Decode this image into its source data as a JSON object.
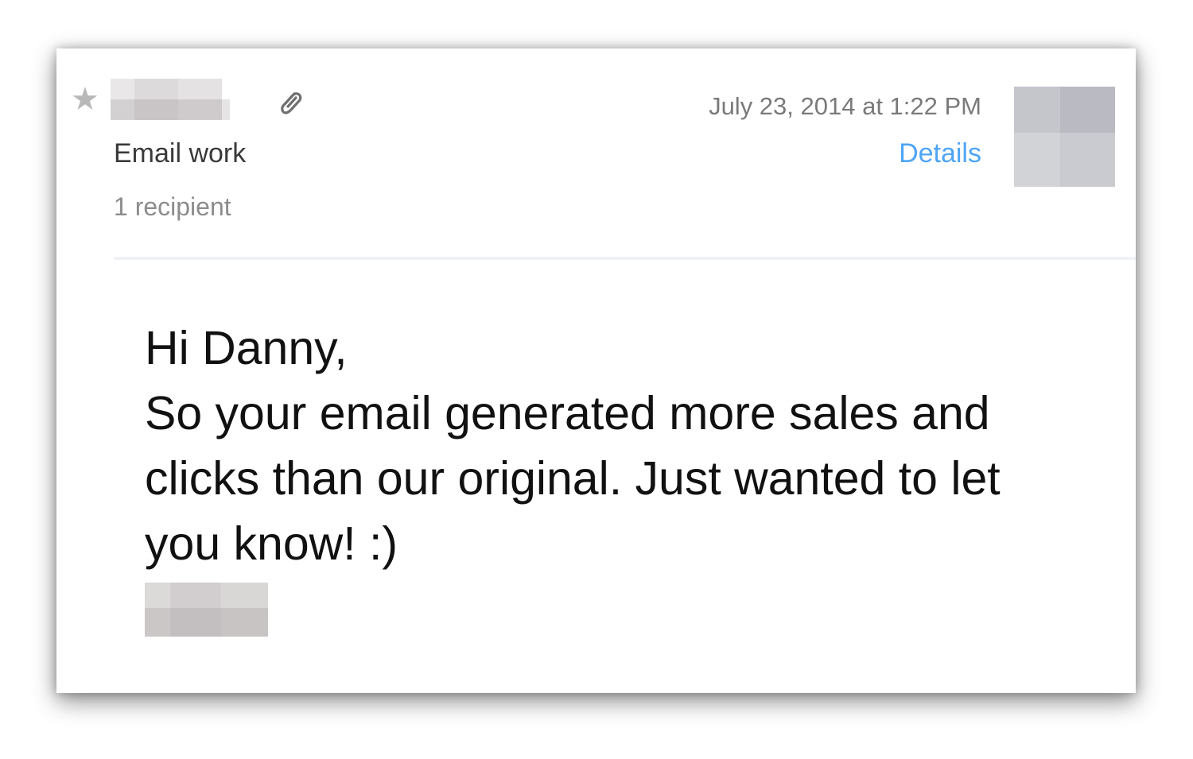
{
  "message": {
    "subject": "Email work",
    "recipients": "1 recipient",
    "timestamp": "July 23, 2014 at 1:22 PM",
    "details_label": "Details",
    "greeting": "Hi Danny,",
    "body": "So  your email generated more sales and clicks than our original. Just wanted to let you know! :)"
  },
  "icons": {
    "star": "star-icon",
    "attachment": "paperclip-icon"
  },
  "colors": {
    "link": "#4ea5f5",
    "star": "#b8b8b8",
    "timestamp": "#7a7a7a"
  }
}
